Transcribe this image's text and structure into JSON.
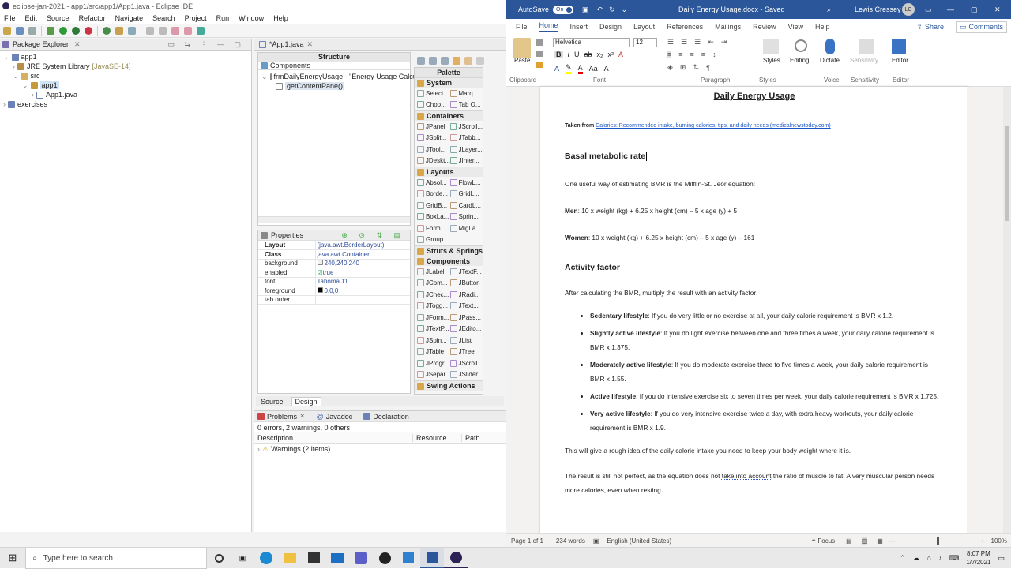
{
  "eclipse": {
    "title": "eclipse-jan-2021 - app1/src/app1/App1.java - Eclipse IDE",
    "menu": [
      "File",
      "Edit",
      "Source",
      "Refactor",
      "Navigate",
      "Search",
      "Project",
      "Run",
      "Window",
      "Help"
    ],
    "package_explorer": {
      "tab": "Package Explorer",
      "tree": [
        "app1",
        "JRE System Library",
        "[JavaSE-14]",
        "src",
        "app1",
        "App1.java",
        "exercises"
      ]
    },
    "editor_tab": "*App1.java",
    "structure": {
      "title": "Structure",
      "components_label": "Components",
      "frame": "frmDailyEnergyUsage - \"Energy Usage Calculator\"",
      "child": "getContentPane()"
    },
    "palette": {
      "title": "Palette",
      "sections": [
        {
          "name": "System",
          "items": [
            "Select...",
            "Marq...",
            "Choo...",
            "Tab O..."
          ]
        },
        {
          "name": "Containers",
          "items": [
            "JPanel",
            "JScroll...",
            "JSplit...",
            "JTabb...",
            "JTool...",
            "JLayer...",
            "JDeskt...",
            "JInter..."
          ]
        },
        {
          "name": "Layouts",
          "items": [
            "Absol...",
            "FlowL...",
            "Borde...",
            "GridL...",
            "GridB...",
            "CardL...",
            "BoxLa...",
            "Sprin...",
            "Form...",
            "MigLa...",
            "Group..."
          ]
        },
        {
          "name": "Struts & Springs",
          "items": []
        },
        {
          "name": "Components",
          "items": [
            "JLabel",
            "JTextF...",
            "JCom...",
            "JButton",
            "JChec...",
            "JRadi...",
            "JTogg...",
            "JText...",
            "JForm...",
            "JPass...",
            "JTextP...",
            "JEdito...",
            "JSpin...",
            "JList",
            "JTable",
            "JTree",
            "JProgr...",
            "JScroll...",
            "JSepar...",
            "JSlider"
          ]
        },
        {
          "name": "Swing Actions",
          "items": []
        }
      ]
    },
    "properties": {
      "title": "Properties",
      "rows": [
        {
          "name": "Layout",
          "value": "(java.awt.BorderLayout)"
        },
        {
          "name": "Class",
          "value": "java.awt.Container"
        },
        {
          "name": "background",
          "value": "240,240,240"
        },
        {
          "name": "enabled",
          "value": "true"
        },
        {
          "name": "font",
          "value": "Tahoma 11"
        },
        {
          "name": "foreground",
          "value": "0,0,0"
        },
        {
          "name": "tab order",
          "value": ""
        }
      ]
    },
    "source_tab": "Source",
    "design_tab": "Design",
    "problems": {
      "tabs": [
        "Problems",
        "Javadoc",
        "Declaration"
      ],
      "summary": "0 errors, 2 warnings, 0 others",
      "columns": [
        "Description",
        "Resource",
        "Path"
      ],
      "row": "Warnings (2 items)"
    }
  },
  "word": {
    "autosave": "AutoSave",
    "autosave_state": "On",
    "title": "Daily Energy Usage.docx - Saved",
    "user": "Lewis Cressey",
    "initials": "LC",
    "tabs": [
      "File",
      "Home",
      "Insert",
      "Design",
      "Layout",
      "References",
      "Mailings",
      "Review",
      "View",
      "Help"
    ],
    "share": "Share",
    "comments": "Comments",
    "font": "Helvetica",
    "size": "12",
    "groups": [
      "Clipboard",
      "Font",
      "Paragraph",
      "Styles",
      "Voice",
      "Sensitivity",
      "Editor"
    ],
    "buttons": {
      "paste": "Paste",
      "styles": "Styles",
      "editing": "Editing",
      "dictate": "Dictate",
      "sensitivity": "Sensitivity",
      "editor": "Editor"
    },
    "doc": {
      "title": "Daily Energy Usage",
      "taken_label": "Taken from",
      "taken_link": "Calories: Recommended intake, burning calories, tips, and daily needs (medicalnewstoday.com)",
      "h1": "Basal metabolic rate",
      "p1": "One useful way of estimating BMR is the Mifflin-St. Jeor equation:",
      "men_label": "Men",
      "men": ": 10 x weight (kg) + 6.25 x height (cm) – 5 x age (y) + 5",
      "women_label": "Women",
      "women": ": 10 x weight (kg) + 6.25 x height (cm) – 5 x age (y) – 161",
      "h2": "Activity factor",
      "p2": "After calculating the BMR, multiply the result with an activity factor:",
      "bullets": [
        {
          "label": "Sedentary lifestyle",
          "text": ": If you do very little or no exercise at all, your daily calorie requirement is BMR x 1.2."
        },
        {
          "label": "Slightly active lifestyle",
          "text": ": If you do light exercise between one and three times a week, your daily calorie requirement is BMR x 1.375."
        },
        {
          "label": "Moderately active lifestyle",
          "text": ": If you do moderate exercise three to five times a week, your daily calorie requirement is BMR x 1.55."
        },
        {
          "label": "Active lifestyle",
          "text": ": If you do intensive exercise six to seven times per week, your daily calorie requirement is BMR x 1.725."
        },
        {
          "label": "Very active lifestyle",
          "text": ": If you do very intensive exercise twice a day, with extra heavy workouts, your daily calorie requirement is BMR x 1.9."
        }
      ],
      "p3": "This will give a rough idea of the daily calorie intake you need to keep your body weight where it is.",
      "p4a": "The result is still not perfect, as the equation does not ",
      "p4u": "take into account",
      "p4b": " the ratio of muscle to fat. A very muscular person needs more calories, even when resting."
    },
    "status": {
      "page": "Page 1 of 1",
      "words": "234 words",
      "lang": "English (United States)",
      "focus": "Focus",
      "zoom": "100%"
    }
  },
  "taskbar": {
    "search": "Type here to search",
    "time": "8:07 PM",
    "date": "1/7/2021"
  }
}
